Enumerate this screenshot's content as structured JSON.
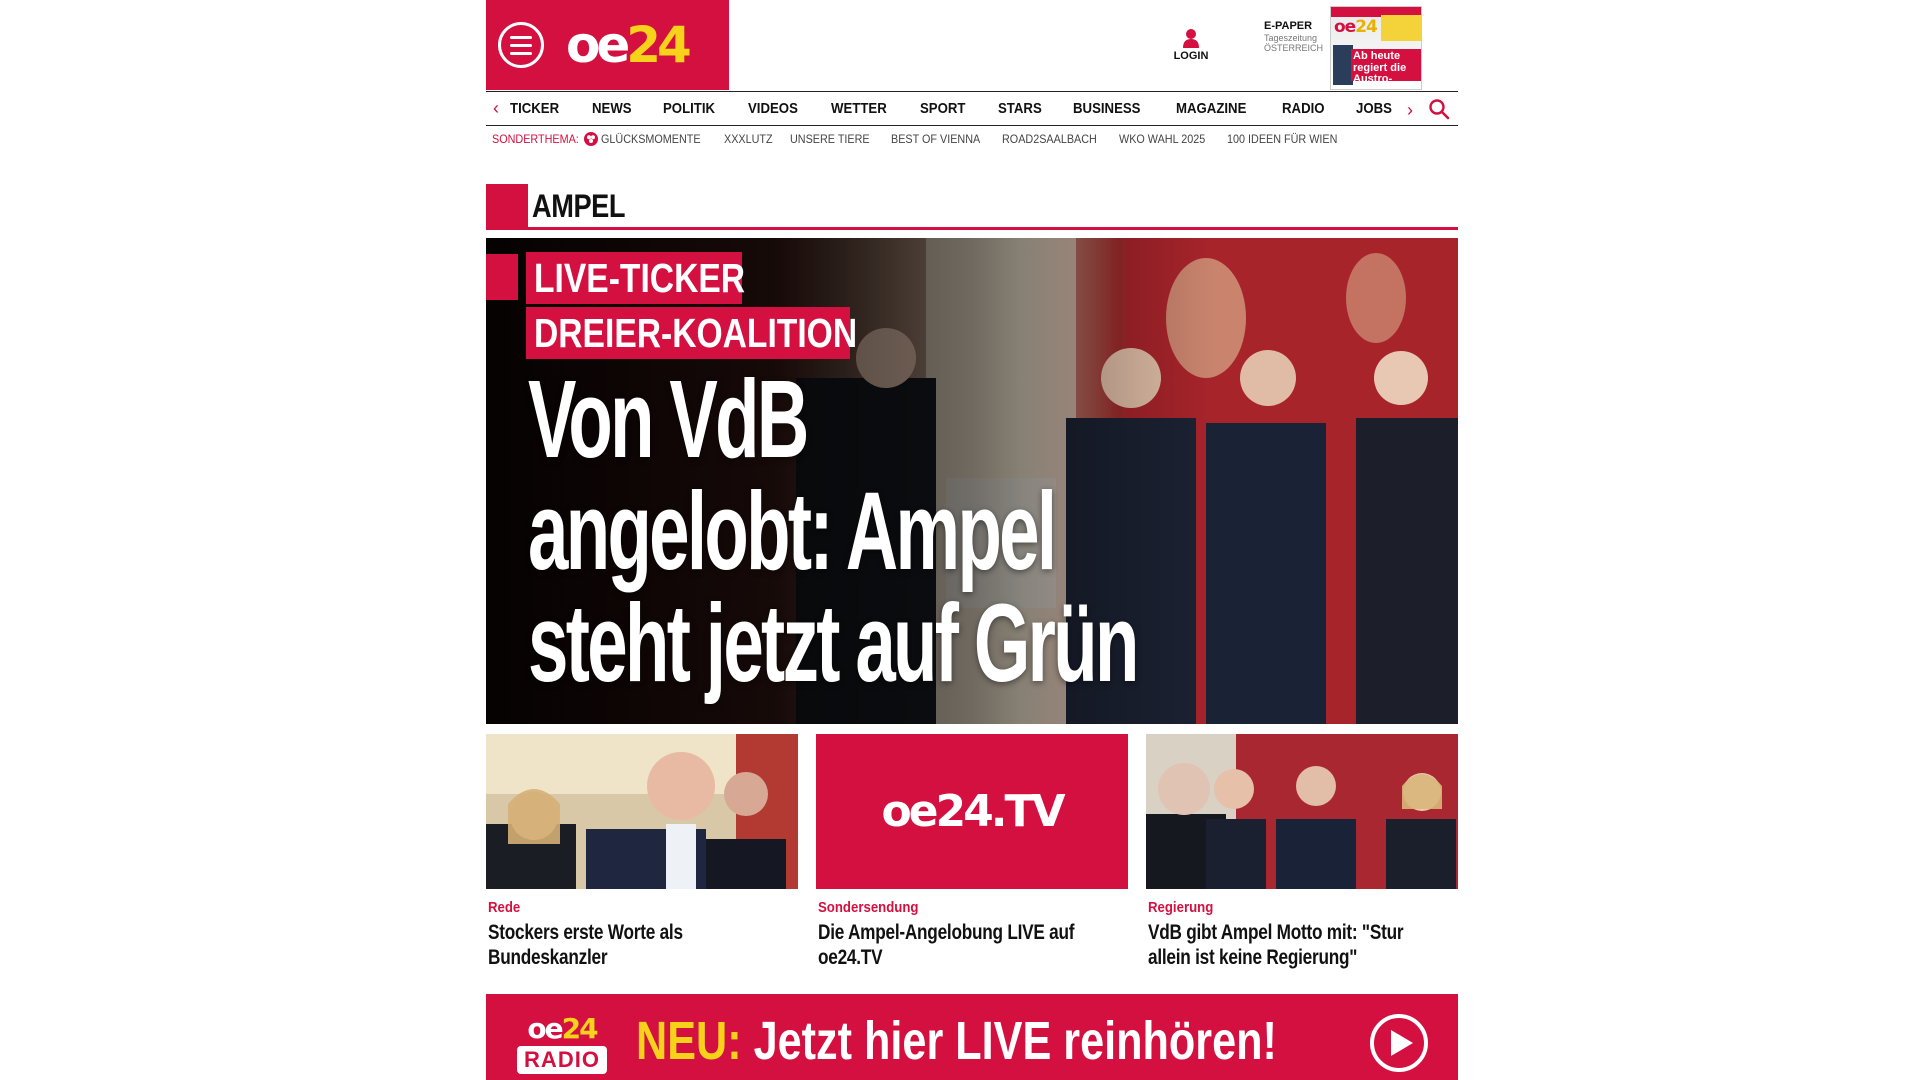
{
  "header": {
    "logo_main": "oe",
    "logo_accent": "24",
    "login_label": "LOGIN",
    "epaper_title": "E-PAPER",
    "epaper_sub1": "Tageszeitung",
    "epaper_sub2": "ÖSTERREICH",
    "epaper_cover_logo_main": "oe",
    "epaper_cover_logo_accent": "24",
    "epaper_cover_headline": "Ab heute regiert die Austro-Ampel"
  },
  "nav": {
    "items": [
      {
        "label": "TICKER"
      },
      {
        "label": "NEWS"
      },
      {
        "label": "POLITIK"
      },
      {
        "label": "VIDEOS"
      },
      {
        "label": "WETTER"
      },
      {
        "label": "SPORT"
      },
      {
        "label": "STARS"
      },
      {
        "label": "BUSINESS"
      },
      {
        "label": "MAGAZINE"
      },
      {
        "label": "RADIO"
      },
      {
        "label": "JOBS"
      }
    ]
  },
  "special": {
    "label": "SONDERTHEMA:",
    "items": [
      {
        "label": "GLÜCKSMOMENTE"
      },
      {
        "label": "XXXLUTZ"
      },
      {
        "label": "UNSERE TIERE"
      },
      {
        "label": "BEST OF VIENNA"
      },
      {
        "label": "ROAD2SAALBACH"
      },
      {
        "label": "WKO WAHL 2025"
      },
      {
        "label": "100 IDEEN FÜR WIEN"
      }
    ]
  },
  "section": {
    "title": "AMPEL"
  },
  "hero": {
    "tag1": "LIVE-TICKER",
    "tag2": "DREIER-KOALITION",
    "headline_line1": "Von VdB",
    "headline_line2": "angelobt: Ampel",
    "headline_line3": "steht jetzt auf Grün"
  },
  "teasers": [
    {
      "kicker": "Rede",
      "title": "Stockers erste Worte als Bundeskanzler"
    },
    {
      "kicker": "Sondersendung",
      "title": "Die Ampel-Angelobung LIVE auf oe24.TV",
      "tv_logo": "oe24.TV"
    },
    {
      "kicker": "Regierung",
      "title": "VdB gibt Ampel Motto mit: \"Stur allein ist keine Regierung\""
    }
  ],
  "radio": {
    "logo_main": "oe",
    "logo_accent": "24",
    "logo_sub": "RADIO",
    "highlight": "NEU:",
    "text": " Jetzt hier LIVE reinhören!"
  },
  "colors": {
    "brand_red": "#d31040",
    "brand_yellow": "#f6d21b"
  }
}
